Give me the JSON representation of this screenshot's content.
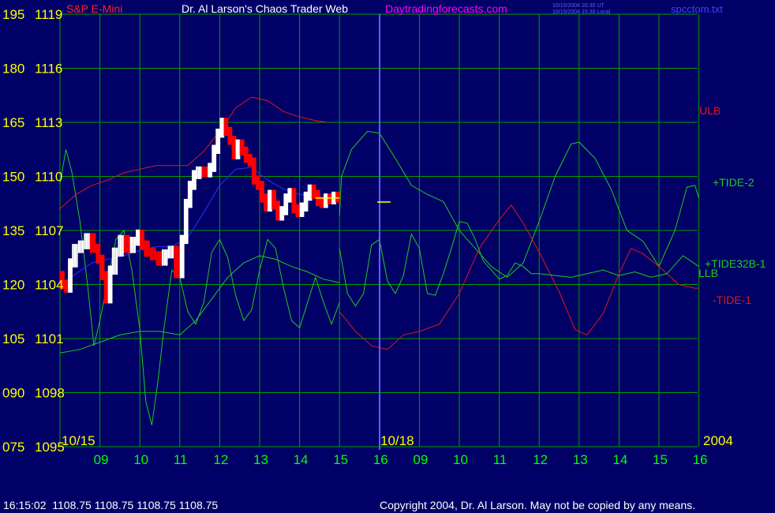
{
  "header": {
    "instrument": "S&P E-Mini",
    "site_title": "Dr. Al Larson's Chaos Trader Web",
    "site_url": "Daytradingforecasts.com",
    "timestamp_ut": "10/15/2004 20:30 UT",
    "timestamp_local": "10/15/2004 15:30 Local",
    "filename": "spcctom.txt"
  },
  "footer": {
    "quote": "16:15:02  1108.75 1108.75 1108.75 1108.75",
    "copyright": "Copyright 2004, Dr. Al Larson. May not be copied by any means."
  },
  "colors": {
    "background": "#000066",
    "grid": "#00a000",
    "price_up": "#ffffff",
    "price_down": "#ff0000",
    "tide_green": "#22c822",
    "tide_red": "#e01818",
    "tide_blue": "#3030ff",
    "now_line": "#6060ff",
    "axis_text": "#ffff00",
    "time_text": "#00ff00",
    "site_url": "#ff00ff",
    "header_text": "#ffffff"
  },
  "chart_data": {
    "type": "line",
    "title": "Dr. Al Larson's Chaos Trader Web",
    "y_left_outer": [
      "195",
      "180",
      "165",
      "150",
      "135",
      "120",
      "105",
      "090",
      "075"
    ],
    "y_left_inner": [
      "1119",
      "1116",
      "1113",
      "1110",
      "1107",
      "1104",
      "1101",
      "1098",
      "1095"
    ],
    "ylim_price": [
      1095,
      1119
    ],
    "x_hours": [
      "09",
      "10",
      "11",
      "12",
      "13",
      "14",
      "15",
      "16",
      "09",
      "10",
      "11",
      "12",
      "13",
      "14",
      "15",
      "16"
    ],
    "date_labels": [
      "10/15",
      "10/18",
      "2004"
    ],
    "series_labels": [
      {
        "text": "ULB",
        "color": "#e01818"
      },
      {
        "text": "+TIDE-2",
        "color": "#22c822"
      },
      {
        "text": "+TIDE32B-1",
        "color": "#22c822"
      },
      {
        "text": "LLB",
        "color": "#22c822"
      },
      {
        "text": "-TIDE-1",
        "color": "#e01818"
      }
    ],
    "last_price": 1108.75,
    "price_path": [
      [
        0.0,
        1104.5
      ],
      [
        0.1,
        1104.0
      ],
      [
        0.2,
        1103.8
      ],
      [
        0.3,
        1105.2
      ],
      [
        0.45,
        1106.0
      ],
      [
        0.6,
        1106.2
      ],
      [
        0.75,
        1106.6
      ],
      [
        0.9,
        1106.0
      ],
      [
        1.0,
        1105.4
      ],
      [
        1.1,
        1104.5
      ],
      [
        1.2,
        1103.2
      ],
      [
        1.3,
        1104.8
      ],
      [
        1.45,
        1105.8
      ],
      [
        1.6,
        1106.5
      ],
      [
        1.75,
        1106.0
      ],
      [
        1.9,
        1106.4
      ],
      [
        2.0,
        1106.8
      ],
      [
        2.1,
        1106.2
      ],
      [
        2.25,
        1105.8
      ],
      [
        2.4,
        1105.6
      ],
      [
        2.55,
        1105.3
      ],
      [
        2.7,
        1105.7
      ],
      [
        2.85,
        1105.9
      ],
      [
        3.0,
        1104.6
      ],
      [
        3.1,
        1106.5
      ],
      [
        3.2,
        1108.5
      ],
      [
        3.3,
        1109.5
      ],
      [
        3.4,
        1110.1
      ],
      [
        3.55,
        1110.3
      ],
      [
        3.7,
        1110.2
      ],
      [
        3.8,
        1110.5
      ],
      [
        3.9,
        1111.5
      ],
      [
        4.0,
        1112.4
      ],
      [
        4.1,
        1113.0
      ],
      [
        4.2,
        1112.5
      ],
      [
        4.3,
        1112.0
      ],
      [
        4.4,
        1111.2
      ],
      [
        4.5,
        1111.8
      ],
      [
        4.6,
        1111.4
      ],
      [
        4.7,
        1111.0
      ],
      [
        4.8,
        1110.8
      ],
      [
        4.9,
        1109.8
      ],
      [
        5.0,
        1109.5
      ],
      [
        5.1,
        1108.8
      ],
      [
        5.2,
        1108.3
      ],
      [
        5.3,
        1109.0
      ],
      [
        5.4,
        1108.4
      ],
      [
        5.5,
        1107.8
      ],
      [
        5.6,
        1108.1
      ],
      [
        5.7,
        1108.8
      ],
      [
        5.8,
        1109.1
      ],
      [
        5.9,
        1108.2
      ],
      [
        6.0,
        1108.0
      ],
      [
        6.1,
        1108.3
      ],
      [
        6.2,
        1108.9
      ],
      [
        6.3,
        1109.3
      ],
      [
        6.4,
        1109.0
      ],
      [
        6.5,
        1108.6
      ],
      [
        6.6,
        1108.5
      ],
      [
        6.7,
        1108.8
      ],
      [
        6.8,
        1108.7
      ],
      [
        6.9,
        1108.9
      ],
      [
        7.0,
        1108.8
      ]
    ],
    "envelope_red": [
      [
        0.0,
        1108.2
      ],
      [
        0.4,
        1109.0
      ],
      [
        0.8,
        1109.5
      ],
      [
        1.2,
        1109.8
      ],
      [
        1.6,
        1110.2
      ],
      [
        2.0,
        1110.4
      ],
      [
        2.4,
        1110.6
      ],
      [
        2.8,
        1110.6
      ],
      [
        3.2,
        1110.6
      ],
      [
        3.6,
        1111.4
      ],
      [
        4.0,
        1112.5
      ],
      [
        4.4,
        1113.8
      ],
      [
        4.8,
        1114.4
      ],
      [
        5.2,
        1114.2
      ],
      [
        5.6,
        1113.6
      ],
      [
        6.0,
        1113.3
      ],
      [
        6.4,
        1113.1
      ],
      [
        6.7,
        1113.0
      ]
    ],
    "trend_blue": [
      [
        0.0,
        1104.0
      ],
      [
        0.4,
        1104.6
      ],
      [
        0.8,
        1105.2
      ],
      [
        1.2,
        1105.4
      ],
      [
        1.6,
        1105.6
      ],
      [
        2.0,
        1105.9
      ],
      [
        2.4,
        1106.1
      ],
      [
        2.8,
        1106.1
      ],
      [
        3.2,
        1106.6
      ],
      [
        3.6,
        1108.0
      ],
      [
        4.0,
        1109.5
      ],
      [
        4.4,
        1110.4
      ],
      [
        4.8,
        1110.5
      ],
      [
        5.2,
        1109.8
      ],
      [
        5.6,
        1109.3
      ],
      [
        6.0,
        1109.0
      ],
      [
        6.4,
        1108.9
      ]
    ],
    "lower_green": [
      [
        0.0,
        1100.2
      ],
      [
        0.5,
        1100.4
      ],
      [
        1.0,
        1100.8
      ],
      [
        1.5,
        1101.2
      ],
      [
        2.0,
        1101.4
      ],
      [
        2.5,
        1101.4
      ],
      [
        3.0,
        1101.2
      ],
      [
        3.4,
        1102.0
      ],
      [
        3.8,
        1103.2
      ],
      [
        4.2,
        1104.4
      ],
      [
        4.6,
        1105.2
      ],
      [
        5.0,
        1105.6
      ],
      [
        5.4,
        1105.4
      ],
      [
        5.8,
        1105.0
      ],
      [
        6.2,
        1104.7
      ],
      [
        6.6,
        1104.3
      ],
      [
        7.0,
        1104.1
      ]
    ],
    "tide2_future": [
      [
        7.0,
        1107.8
      ],
      [
        7.05,
        1110.0
      ],
      [
        7.3,
        1111.5
      ],
      [
        7.7,
        1112.5
      ],
      [
        8.0,
        1112.4
      ],
      [
        8.4,
        1111.0
      ],
      [
        8.8,
        1109.5
      ],
      [
        9.2,
        1109.0
      ],
      [
        9.6,
        1108.6
      ],
      [
        10.0,
        1107.0
      ],
      [
        10.4,
        1106.0
      ],
      [
        10.8,
        1105.0
      ],
      [
        11.2,
        1104.4
      ],
      [
        11.6,
        1105.2
      ],
      [
        12.0,
        1107.5
      ],
      [
        12.4,
        1110.0
      ],
      [
        12.8,
        1111.8
      ],
      [
        13.0,
        1111.9
      ],
      [
        13.4,
        1111.0
      ],
      [
        13.8,
        1109.3
      ],
      [
        14.2,
        1107.0
      ],
      [
        14.6,
        1106.4
      ],
      [
        15.0,
        1105.0
      ],
      [
        15.4,
        1107.0
      ],
      [
        15.7,
        1109.4
      ],
      [
        15.9,
        1109.5
      ],
      [
        16.0,
        1108.8
      ]
    ],
    "tide1_future": [
      [
        7.0,
        1102.5
      ],
      [
        7.4,
        1101.4
      ],
      [
        7.8,
        1100.6
      ],
      [
        8.2,
        1100.4
      ],
      [
        8.6,
        1101.2
      ],
      [
        9.0,
        1101.4
      ],
      [
        9.5,
        1101.8
      ],
      [
        10.0,
        1103.5
      ],
      [
        10.5,
        1106.0
      ],
      [
        11.0,
        1107.6
      ],
      [
        11.3,
        1108.4
      ],
      [
        11.6,
        1107.4
      ],
      [
        12.0,
        1105.8
      ],
      [
        12.5,
        1103.6
      ],
      [
        12.9,
        1101.5
      ],
      [
        13.2,
        1101.2
      ],
      [
        13.6,
        1102.4
      ],
      [
        14.0,
        1104.6
      ],
      [
        14.3,
        1106.0
      ],
      [
        14.6,
        1105.7
      ],
      [
        15.0,
        1105.0
      ],
      [
        15.5,
        1104.0
      ],
      [
        15.9,
        1103.8
      ],
      [
        16.0,
        1103.8
      ]
    ],
    "tide32b_future": [
      [
        7.0,
        1106.0
      ],
      [
        7.2,
        1103.5
      ],
      [
        7.4,
        1102.8
      ],
      [
        7.6,
        1103.5
      ],
      [
        7.8,
        1106.2
      ],
      [
        8.0,
        1106.5
      ],
      [
        8.2,
        1104.2
      ],
      [
        8.4,
        1103.5
      ],
      [
        8.6,
        1104.5
      ],
      [
        8.8,
        1106.8
      ],
      [
        9.0,
        1106.0
      ],
      [
        9.2,
        1103.5
      ],
      [
        9.4,
        1103.4
      ],
      [
        9.6,
        1104.6
      ],
      [
        9.8,
        1106.0
      ],
      [
        10.0,
        1107.5
      ],
      [
        10.2,
        1107.4
      ],
      [
        10.4,
        1106.5
      ],
      [
        10.6,
        1105.3
      ],
      [
        10.8,
        1104.8
      ],
      [
        11.0,
        1104.3
      ],
      [
        11.2,
        1104.5
      ],
      [
        11.4,
        1105.2
      ],
      [
        11.6,
        1105.0
      ],
      [
        11.8,
        1104.6
      ],
      [
        12.0,
        1104.6
      ],
      [
        12.4,
        1104.5
      ],
      [
        12.8,
        1104.4
      ],
      [
        13.2,
        1104.6
      ],
      [
        13.6,
        1104.8
      ],
      [
        14.0,
        1104.5
      ],
      [
        14.4,
        1104.7
      ],
      [
        14.8,
        1104.4
      ],
      [
        15.2,
        1104.6
      ],
      [
        15.6,
        1105.6
      ],
      [
        16.0,
        1105.0
      ]
    ],
    "tide_past_green": [
      [
        0.0,
        1109.6
      ],
      [
        0.15,
        1111.5
      ],
      [
        0.3,
        1110.2
      ],
      [
        0.5,
        1107.5
      ],
      [
        0.7,
        1103.8
      ],
      [
        0.85,
        1100.6
      ],
      [
        1.0,
        1102.0
      ],
      [
        1.2,
        1104.2
      ],
      [
        1.4,
        1106.5
      ],
      [
        1.6,
        1107.0
      ],
      [
        1.8,
        1104.8
      ],
      [
        2.0,
        1101.5
      ],
      [
        2.15,
        1097.5
      ],
      [
        2.3,
        1096.2
      ],
      [
        2.45,
        1098.6
      ],
      [
        2.6,
        1101.5
      ],
      [
        2.8,
        1104.8
      ],
      [
        3.0,
        1104.4
      ],
      [
        3.2,
        1102.5
      ],
      [
        3.4,
        1101.8
      ],
      [
        3.6,
        1103.0
      ],
      [
        3.8,
        1105.8
      ],
      [
        4.0,
        1106.5
      ],
      [
        4.2,
        1105.5
      ],
      [
        4.4,
        1103.4
      ],
      [
        4.6,
        1102.0
      ],
      [
        4.8,
        1102.6
      ],
      [
        5.0,
        1104.8
      ],
      [
        5.2,
        1106.5
      ],
      [
        5.4,
        1106.0
      ],
      [
        5.6,
        1103.8
      ],
      [
        5.8,
        1102.0
      ],
      [
        6.0,
        1101.6
      ],
      [
        6.2,
        1103.0
      ],
      [
        6.4,
        1104.4
      ],
      [
        6.6,
        1103.0
      ],
      [
        6.8,
        1101.8
      ],
      [
        7.0,
        1103.0
      ]
    ]
  }
}
